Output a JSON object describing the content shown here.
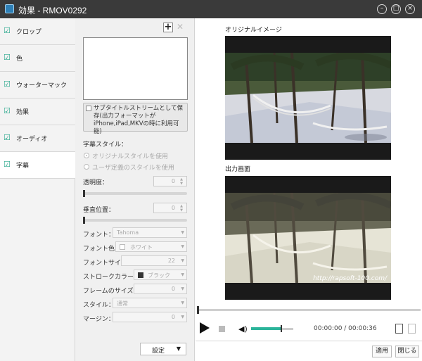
{
  "window": {
    "title": "効果 - RMOV0292",
    "minimize_icon": "minimize-icon",
    "maximize_icon": "maximize-icon",
    "close_icon": "close-icon"
  },
  "sidebar": {
    "items": [
      {
        "label": "クロップ",
        "checked": true,
        "active": false
      },
      {
        "label": "色",
        "checked": true,
        "active": false
      },
      {
        "label": "ウォーターマック",
        "checked": true,
        "active": false
      },
      {
        "label": "効果",
        "checked": true,
        "active": false
      },
      {
        "label": "オーディオ",
        "checked": true,
        "active": false
      },
      {
        "label": "字幕",
        "checked": true,
        "active": true
      }
    ]
  },
  "subtitle_panel": {
    "save_stream_label": "サブタイトルストリームとして保存(出力フォーマットがiPhone,iPad,MKVの時に利用可能)",
    "style_heading": "字幕スタイル：",
    "radio_original": "オリジナルスタイルを使用",
    "radio_custom": "ユーザ定義のスタイルを使用",
    "transparency_label": "透明度：",
    "transparency_value": "0",
    "vertical_label": "垂直位置：",
    "vertical_value": "0",
    "font_label": "フォント：",
    "font_value": "Tahoma",
    "font_color_label": "フォント色：",
    "font_color_value": "ホワイト",
    "font_size_label": "フォントサイズ：",
    "font_size_value": "22",
    "stroke_color_label": "ストロークカラー：",
    "stroke_color_value": "ブラック",
    "frame_size_label": "フレームのサイズ：",
    "frame_size_value": "0",
    "style_label": "スタイル：",
    "style_value": "通常",
    "margin_label": "マージン：",
    "margin_value": "0",
    "settings_button": "設定"
  },
  "preview": {
    "original_label": "オリジナルイメージ",
    "output_label": "出力画面",
    "watermark": "http://rapsoft-100.com/",
    "time": "00:00:00 / 00:00:36",
    "volume": 0.7
  },
  "footer": {
    "apply": "適用",
    "close": "閉じる"
  },
  "colors": {
    "accent": "#2bb49a",
    "titlebar": "#3a3a3a"
  }
}
